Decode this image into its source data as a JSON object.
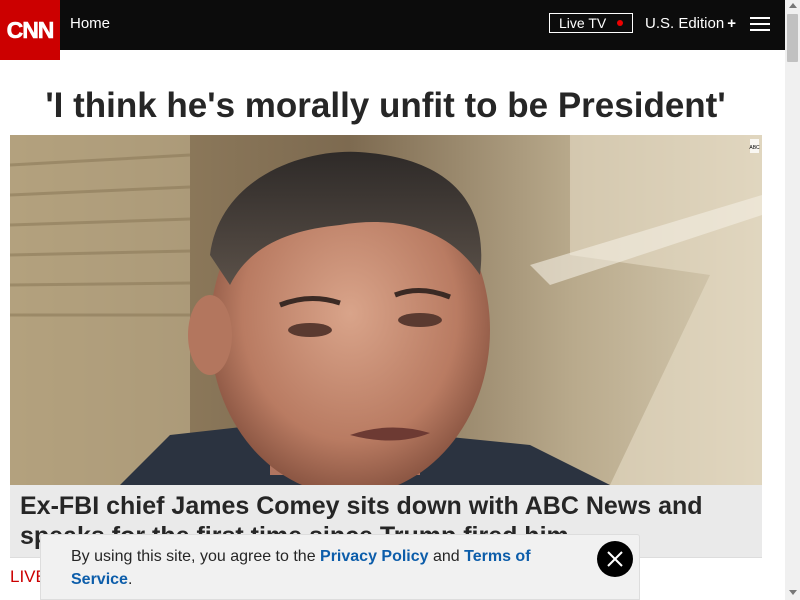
{
  "header": {
    "logo_text": "CNN",
    "home_label": "Home",
    "live_tv_label": "Live TV",
    "edition_label": "U.S. Edition",
    "edition_plus": "+"
  },
  "article": {
    "headline": "'I think he's morally unfit to be President'",
    "caption": "Ex-FBI chief James Comey sits down with ABC News and speaks for the first time since Trump fired him",
    "watermark_text": "ABC",
    "live_label": "LIVE"
  },
  "cookie_notice": {
    "text_before": "By using this site, you agree to the ",
    "privacy_link": "Privacy Policy",
    "text_middle": " and ",
    "terms_link": "Terms of Service",
    "text_after": "."
  },
  "colors": {
    "brand_red": "#cc0000",
    "nav_bg": "#0c0c0c",
    "link_blue": "#0c5daa"
  },
  "icons": [
    "menu-icon",
    "close-icon",
    "live-dot-icon",
    "scroll-up-icon",
    "scroll-down-icon"
  ]
}
